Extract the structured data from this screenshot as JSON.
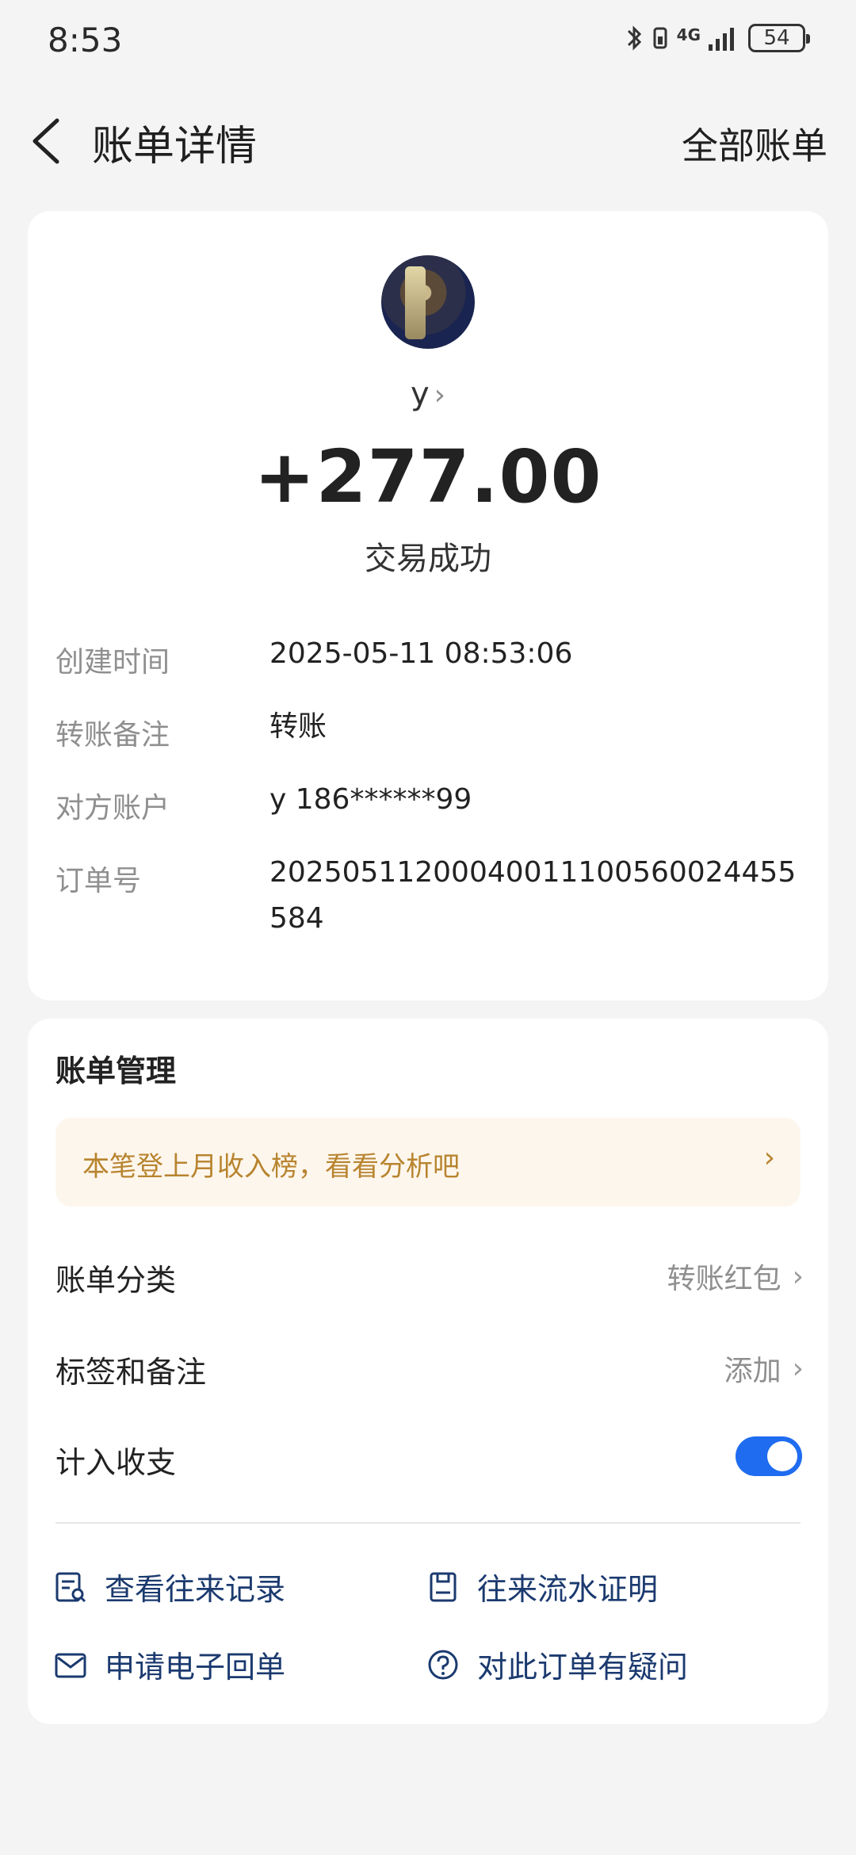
{
  "status_bar": {
    "time": "8:53",
    "network": "4G",
    "battery": "54"
  },
  "header": {
    "title": "账单详情",
    "all_bills": "全部账单"
  },
  "transaction": {
    "payer": "y",
    "amount": "+277.00",
    "status": "交易成功"
  },
  "details": [
    {
      "label": "创建时间",
      "value": "2025-05-11 08:53:06"
    },
    {
      "label": "转账备注",
      "value": "转账"
    },
    {
      "label": "对方账户",
      "value": "y 186******99"
    },
    {
      "label": "订单号",
      "value": "20250511200040011100560024455584"
    }
  ],
  "management": {
    "title": "账单管理",
    "banner": "本笔登上月收入榜，看看分析吧",
    "category_label": "账单分类",
    "category_value": "转账红包",
    "tags_label": "标签和备注",
    "tags_value": "添加",
    "include_label": "计入收支"
  },
  "actions": {
    "view_records": "查看往来记录",
    "flow_proof": "往来流水证明",
    "e_receipt": "申请电子回单",
    "question": "对此订单有疑问"
  },
  "colors": {
    "accent_blue": "#1f6cf0",
    "action_text": "#1b3a6f",
    "banner_text": "#b8842f",
    "banner_bg": "#fdf6ec"
  }
}
